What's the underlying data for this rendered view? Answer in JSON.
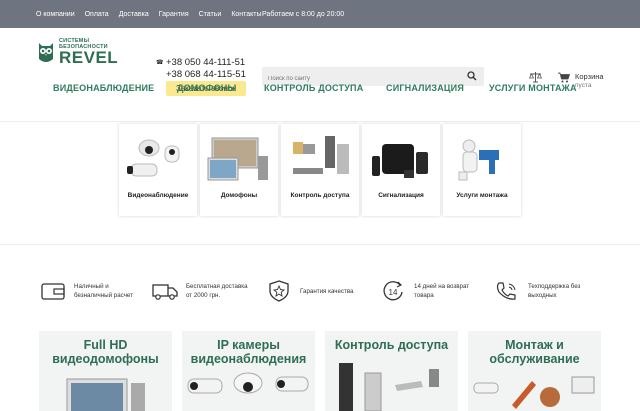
{
  "topbar": {
    "links": [
      "О компании",
      "Оплата",
      "Доставка",
      "Гарантия",
      "Статьи",
      "Контакты"
    ],
    "hours": "Работаем с 8:00 до 20:00"
  },
  "logo": {
    "sub1": "СИСТЕМЫ",
    "sub2": "БЕЗОПАСНОСТИ",
    "brand": "REVEL"
  },
  "phones": [
    "+38 050 44-111-51",
    "+38 068 44-115-51"
  ],
  "callback": "Заказать звонок",
  "search": {
    "placeholder": "Поиск по сайту"
  },
  "cart": {
    "label": "Корзина",
    "status": "пуста"
  },
  "nav": [
    "ВИДЕОНАБЛЮДЕНИЕ",
    "ДОМОФОНЫ",
    "КОНТРОЛЬ ДОСТУПА",
    "СИГНАЛИЗАЦИЯ",
    "УСЛУГИ МОНТАЖА"
  ],
  "categories": [
    "Видеонаблюдение",
    "Домофоны",
    "Контроль доступа",
    "Сигнализация",
    "Услуги монтажа"
  ],
  "features": [
    {
      "l1": "Наличный и",
      "l2": "безналичный расчет"
    },
    {
      "l1": "Бесплатная доставка",
      "l2": "от 2000 грн."
    },
    {
      "l1": "Гарантия качества",
      "l2": ""
    },
    {
      "l1": "14 дней на возврат",
      "l2": "товара"
    },
    {
      "l1": "Техподдержка без",
      "l2": "выходных"
    }
  ],
  "feature_icons": [
    "wallet-icon",
    "truck-icon",
    "shield-star-icon",
    "return-14-icon",
    "phone-support-icon"
  ],
  "return_days": "14",
  "banners": [
    {
      "l1": "Full HD",
      "l2": "видеодомофоны"
    },
    {
      "l1": "IP камеры",
      "l2": "видеонаблюдения"
    },
    {
      "l1": "Контроль доступа",
      "l2": ""
    },
    {
      "l1": "Монтаж и",
      "l2": "обслуживание"
    }
  ],
  "colors": {
    "brand": "#2e6e55",
    "nav": "#2e7d5e",
    "topbar": "#6e7580",
    "callback": "#fbe98e"
  }
}
